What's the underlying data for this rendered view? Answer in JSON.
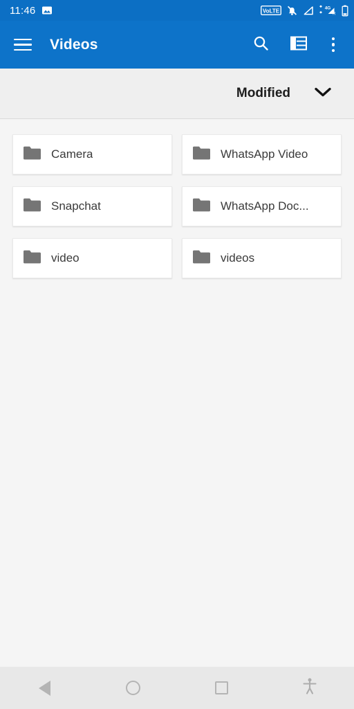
{
  "status_bar": {
    "time": "11:46",
    "notification_icons": [
      "image-icon"
    ],
    "system_icons": [
      "volte-badge",
      "notifications-muted-icon",
      "signal-bar-icon",
      "data-4g-roaming-icon",
      "battery-icon"
    ],
    "volte_label": "VoLTE",
    "network_label": "4G",
    "roaming_label": "R",
    "background_color": "#0c6fc4"
  },
  "app_bar": {
    "title": "Videos",
    "menu_icon": "hamburger-icon",
    "actions": [
      {
        "name": "search",
        "icon": "search-icon"
      },
      {
        "name": "view-mode",
        "icon": "list-view-icon"
      },
      {
        "name": "overflow",
        "icon": "more-vertical-icon"
      }
    ],
    "background_color": "#0d73c9"
  },
  "sort_bar": {
    "label": "Modified",
    "chevron_icon": "chevron-down-icon",
    "background_color": "#efefef"
  },
  "folders": [
    {
      "name": "Camera",
      "icon": "folder-icon"
    },
    {
      "name": "WhatsApp Video",
      "icon": "folder-icon"
    },
    {
      "name": "Snapchat",
      "icon": "folder-icon"
    },
    {
      "name": "WhatsApp Doc...",
      "icon": "folder-icon"
    },
    {
      "name": "video",
      "icon": "folder-icon"
    },
    {
      "name": "videos",
      "icon": "folder-icon"
    }
  ],
  "nav_bar": {
    "buttons": [
      {
        "name": "back",
        "icon": "triangle-back-icon"
      },
      {
        "name": "home",
        "icon": "circle-home-icon"
      },
      {
        "name": "recents",
        "icon": "square-recents-icon"
      },
      {
        "name": "accessibility",
        "icon": "accessibility-icon"
      }
    ],
    "background_color": "#e8e8e8"
  }
}
